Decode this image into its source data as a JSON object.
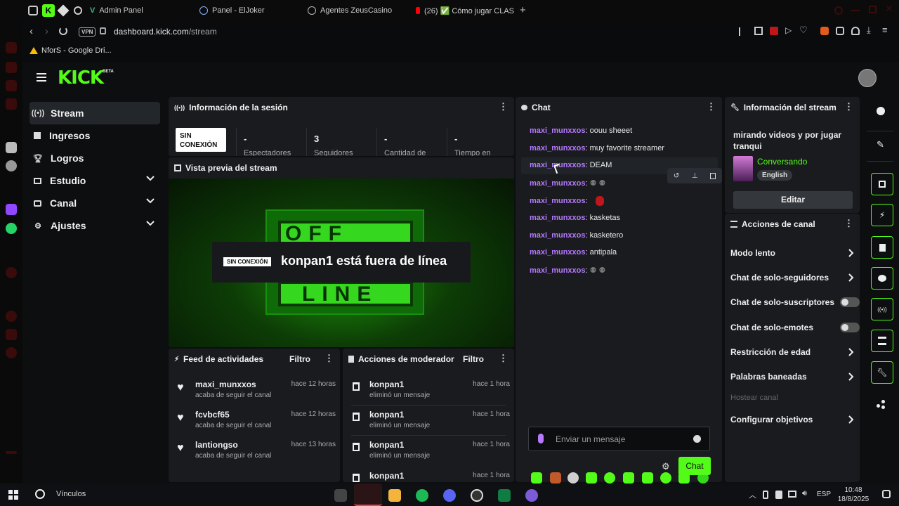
{
  "browser": {
    "tabs": [
      {
        "label": "Admin Panel"
      },
      {
        "label": "Panel - ElJoker"
      },
      {
        "label": "Agentes ZeusCasino"
      },
      {
        "label": "(26) ✅ Cómo jugar CLAS"
      }
    ],
    "address": {
      "vpn": "VPN",
      "host": "dashboard.kick.com",
      "path": "/stream"
    },
    "bookmark": "NforS - Google Dri..."
  },
  "header": {
    "logo": "KICK",
    "beta": "BETA"
  },
  "sidebar": {
    "items": [
      {
        "label": "Stream",
        "active": true
      },
      {
        "label": "Ingresos"
      },
      {
        "label": "Logros"
      },
      {
        "label": "Estudio",
        "expandable": true
      },
      {
        "label": "Canal",
        "expandable": true
      },
      {
        "label": "Ajustes",
        "expandable": true
      }
    ]
  },
  "session": {
    "title": "Información de la sesión",
    "badge": "SIN CONEXIÓN",
    "stats": [
      {
        "value": "-",
        "label": "Espectadores"
      },
      {
        "value": "3",
        "label": "Seguidores"
      },
      {
        "value": "-",
        "label": "Cantidad de"
      },
      {
        "value": "-",
        "label": "Tiempo en"
      }
    ]
  },
  "preview": {
    "title": "Vista previa del stream",
    "badge": "SIN CONEXIÓN",
    "message": "konpan1 está fuera de línea",
    "sign_top": "OFF",
    "sign_bottom": "LINE"
  },
  "feed": {
    "title": "Feed de actividades",
    "filter": "Filtro",
    "items": [
      {
        "name": "maxi_munxxos",
        "time": "hace 12 horas",
        "sub": "acaba de seguir el canal"
      },
      {
        "name": "fcvbcf65",
        "time": "hace 12 horas",
        "sub": "acaba de seguir el canal"
      },
      {
        "name": "lantiongso",
        "time": "hace 13 horas",
        "sub": "acaba de seguir el canal"
      }
    ]
  },
  "mod": {
    "title": "Acciones de moderador",
    "filter": "Filtro",
    "items": [
      {
        "name": "konpan1",
        "time": "hace 1 hora",
        "sub": "eliminó un mensaje"
      },
      {
        "name": "konpan1",
        "time": "hace 1 hora",
        "sub": "eliminó un mensaje"
      },
      {
        "name": "konpan1",
        "time": "hace 1 hora",
        "sub": "eliminó un mensaje"
      },
      {
        "name": "konpan1",
        "time": "hace 1 hora",
        "sub": ""
      }
    ]
  },
  "chat": {
    "title": "Chat",
    "messages": [
      {
        "user": "maxi_munxxos",
        "text": "oouu sheeet"
      },
      {
        "user": "maxi_munxxos",
        "text": "muy favorite streamer"
      },
      {
        "user": "maxi_munxxos",
        "text": "DEAM"
      },
      {
        "user": "maxi_munxxos",
        "text": ""
      },
      {
        "user": "maxi_munxxos",
        "text": ""
      },
      {
        "user": "maxi_munxxos",
        "text": "kasketas"
      },
      {
        "user": "maxi_munxxos",
        "text": "kasketero"
      },
      {
        "user": "maxi_munxxos",
        "text": "antipala"
      },
      {
        "user": "maxi_munxxos",
        "text": ""
      }
    ],
    "input_placeholder": "Enviar un mensaje",
    "send": "Chat"
  },
  "stream_info": {
    "title": "Información del stream",
    "stream_title": "mirando videos y por jugar tranqui",
    "category": "Conversando",
    "language": "English",
    "edit": "Editar"
  },
  "channel_actions": {
    "title": "Acciones de canal",
    "items": [
      {
        "label": "Modo lento",
        "kind": "arrow"
      },
      {
        "label": "Chat de solo-seguidores",
        "kind": "arrow"
      },
      {
        "label": "Chat de solo-suscriptores",
        "kind": "toggle"
      },
      {
        "label": "Chat de solo-emotes",
        "kind": "toggle"
      },
      {
        "label": "Restricción de edad",
        "kind": "arrow"
      },
      {
        "label": "Palabras baneadas",
        "kind": "arrow"
      },
      {
        "label": "Hostear canal",
        "kind": "disabled"
      },
      {
        "label": "Configurar objetivos",
        "kind": "arrow"
      }
    ]
  },
  "taskbar": {
    "search": "Vínculos",
    "lang": "ESP",
    "time": "10:48",
    "date": "18/8/2025"
  },
  "colors": {
    "accent": "#53fc18",
    "username": "#b779ff",
    "panel": "#191b1f"
  }
}
